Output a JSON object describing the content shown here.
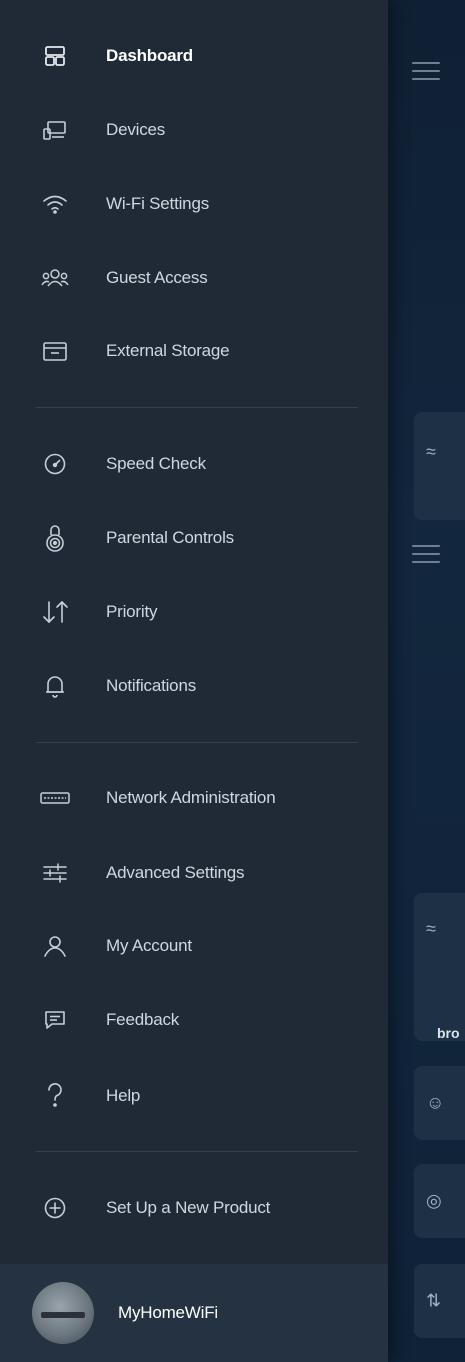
{
  "drawer": {
    "groups": [
      [
        {
          "label": "Dashboard",
          "icon": "dashboard-icon",
          "active": true
        },
        {
          "label": "Devices",
          "icon": "devices-icon"
        },
        {
          "label": "Wi-Fi Settings",
          "icon": "wifi-icon"
        },
        {
          "label": "Guest Access",
          "icon": "guest-access-icon"
        },
        {
          "label": "External Storage",
          "icon": "external-storage-icon"
        }
      ],
      [
        {
          "label": "Speed Check",
          "icon": "speedometer-icon"
        },
        {
          "label": "Parental Controls",
          "icon": "parental-lock-icon"
        },
        {
          "label": "Priority",
          "icon": "priority-arrows-icon"
        },
        {
          "label": "Notifications",
          "icon": "bell-icon"
        }
      ],
      [
        {
          "label": "Network Administration",
          "icon": "keyboard-icon"
        },
        {
          "label": "Advanced Settings",
          "icon": "sliders-icon"
        },
        {
          "label": "My Account",
          "icon": "person-icon"
        },
        {
          "label": "Feedback",
          "icon": "chat-bubble-icon"
        },
        {
          "label": "Help",
          "icon": "question-mark-icon"
        }
      ],
      [
        {
          "label": "Set Up a New Product",
          "icon": "plus-circle-icon"
        }
      ]
    ],
    "profile": {
      "name": "MyHomeWiFi",
      "icon": "avatar"
    }
  },
  "background": {
    "partial_text": "bro"
  },
  "colors": {
    "drawer_bg": "#1f2a36",
    "app_bg": "#12243a",
    "text": "#d0d7df"
  }
}
